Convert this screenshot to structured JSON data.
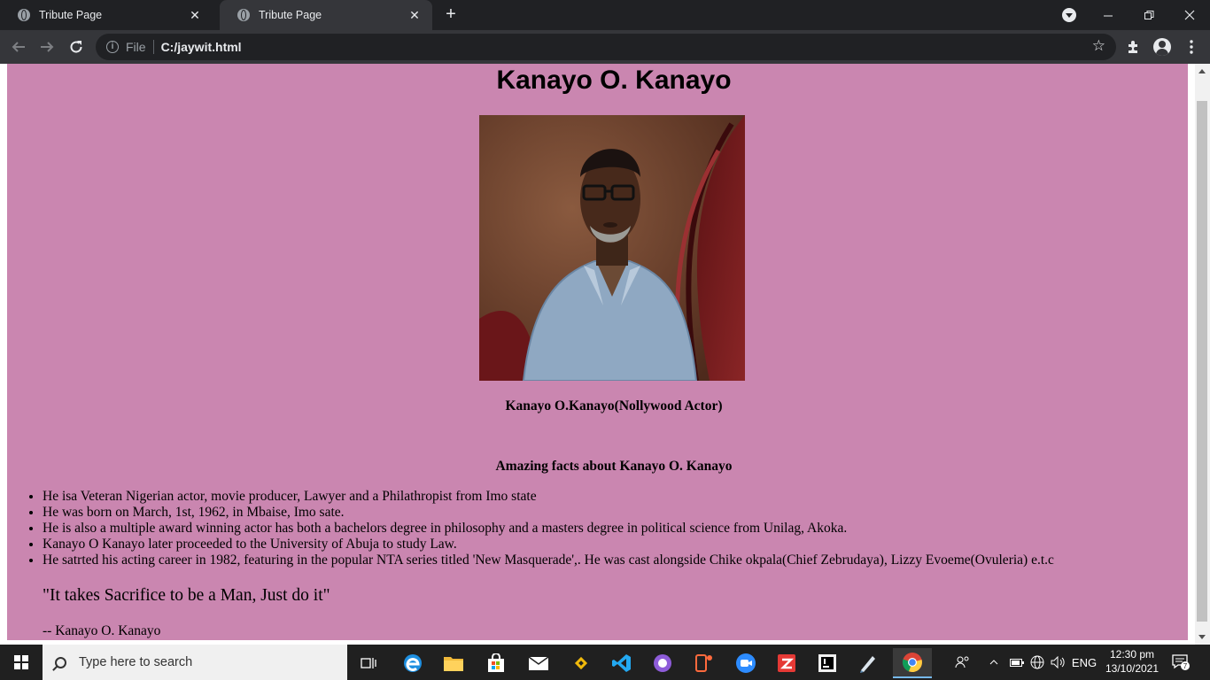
{
  "browser": {
    "tabs": [
      {
        "title": "Tribute Page",
        "active": false
      },
      {
        "title": "Tribute Page",
        "active": true
      }
    ],
    "scheme_label": "File",
    "url": "C:/jaywit.html"
  },
  "page": {
    "background_color": "#ca86b0",
    "heading": "Kanayo O. Kanayo",
    "image_caption": "Kanayo O.Kanayo(Nollywood Actor)",
    "facts_heading": "Amazing facts about Kanayo O. Kanayo",
    "facts": [
      "He isa Veteran Nigerian actor, movie producer, Lawyer and a Philathropist from Imo state",
      "He was born on March, 1st, 1962, in Mbaise, Imo sate.",
      "He is also a multiple award winning actor has both a bachelors degree in philosophy and a masters degree in political science from Unilag, Akoka.",
      "Kanayo O Kanayo later proceeded to the University of Abuja to study Law.",
      "He satrted his acting career in 1982, featuring in the popular NTA series titled 'New Masquerade',. He was cast alongside Chike okpala(Chief Zebrudaya), Lizzy Evoeme(Ovuleria) e.t.c"
    ],
    "quote": "\"It takes Sacrifice to be a Man, Just do it\"",
    "quote_author": "-- Kanayo O. Kanayo"
  },
  "taskbar": {
    "search_placeholder": "Type here to search",
    "language": "ENG",
    "time": "12:30 pm",
    "date": "13/10/2021",
    "notification_count": "7"
  }
}
